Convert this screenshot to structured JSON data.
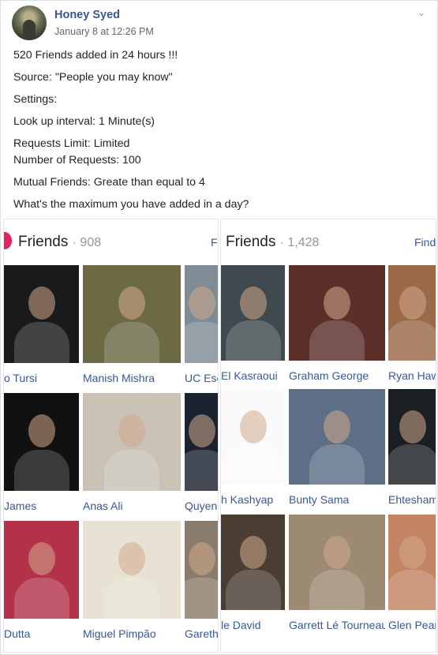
{
  "post": {
    "author": "Honey Syed",
    "timestamp": "January 8 at 12:26 PM",
    "lines": [
      "520 Friends added in 24 hours !!!",
      "Source: \"People you may know\"",
      "Settings:",
      "Look up interval: 1 Minute(s)",
      "Requests Limit: Limited",
      "Number of Requests: 100",
      "Mutual Friends: Greate than equal to 4",
      "What's the maximum you have added in a day?"
    ]
  },
  "left_panel": {
    "title": "Friends",
    "count": "· 908",
    "find": "Fi",
    "friends": [
      {
        "name": "o Tursi",
        "color": "#1a1a1a"
      },
      {
        "name": "Manish Mishra",
        "color": "#6b6a45"
      },
      {
        "name": "UC Esc",
        "color": "#7f8c96"
      },
      {
        "name": "James",
        "color": "#111111"
      },
      {
        "name": "Anas Ali",
        "color": "#c9c2b5"
      },
      {
        "name": "Quyen",
        "color": "#1c2330"
      },
      {
        "name": "Dutta",
        "color": "#b3324a"
      },
      {
        "name": "Miguel Pimpão",
        "color": "#e7e2d3"
      },
      {
        "name": "Gareth",
        "color": "#8a7c6c"
      }
    ]
  },
  "right_panel": {
    "title": "Friends",
    "count": "· 1,428",
    "find": "Find",
    "friends": [
      {
        "name": "El Kasraoui",
        "color": "#3f4a4e"
      },
      {
        "name": "Graham George",
        "color": "#5b2f2a"
      },
      {
        "name": "Ryan Haw",
        "color": "#9a6a49"
      },
      {
        "name": "h Kashyap",
        "color": "#fafafa"
      },
      {
        "name": "Bunty Sama",
        "color": "#5c6f86"
      },
      {
        "name": "Ehtesham",
        "color": "#1a1f24"
      },
      {
        "name": "le David",
        "color": "#4a3e33"
      },
      {
        "name": "Garrett Lé Tourneau",
        "color": "#9c8a73"
      },
      {
        "name": "Glen Pear",
        "color": "#c28463"
      }
    ]
  }
}
